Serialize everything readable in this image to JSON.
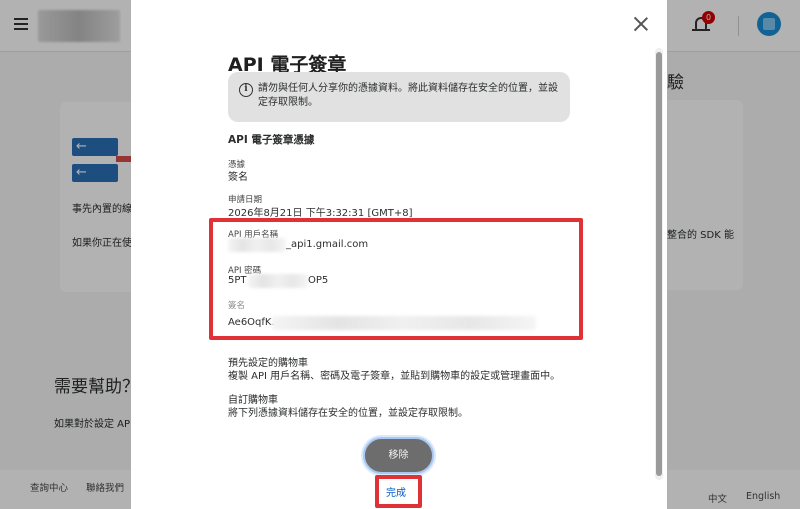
{
  "background": {
    "heading_right_partial": "驗",
    "left_card_line1": "事先內置的線",
    "left_card_line2": "如果你正在使",
    "right_card_line": "整合的 SDK 能",
    "help_heading": "需要幫助？",
    "help_text": "如果對於設定 API",
    "notification_count": "0",
    "footer": {
      "help_center": "查詢中心",
      "contact_us": "聯絡我們",
      "lang_zh": "中文",
      "lang_en": "English"
    }
  },
  "modal": {
    "title": "API 電子簽章",
    "notice": "請勿與任何人分享你的憑據資料。將此資料儲存在安全的位置，並設定存取限制。",
    "section_title": "API 電子簽章憑據",
    "credential_label": "憑據",
    "credential_value": "簽名",
    "request_date_label": "申請日期",
    "request_date_value": "2026年8月21日 下午3:32:31 [GMT+8]",
    "api_username_label": "API 用戶名稱",
    "api_username_value": "_api1.gmail.com",
    "api_password_label": "API 密碼",
    "api_password_prefix": "5PT",
    "api_password_suffix": "OP5",
    "signature_label": "簽名",
    "signature_prefix": "Ae6OqfK.",
    "preset_cart_title": "預先設定的購物車",
    "preset_cart_text": "複製 API 用戶名稱、密碼及電子簽章，並貼到購物車的設定或管理畫面中。",
    "custom_cart_title": "自訂購物車",
    "custom_cart_text": "將下列憑據資料儲存在安全的位置，並設定存取限制。",
    "remove_button": "移除",
    "done_link": "完成"
  }
}
